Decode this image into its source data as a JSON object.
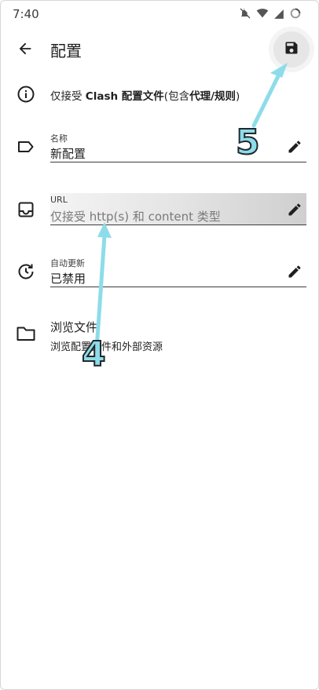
{
  "status_bar": {
    "time": "7:40"
  },
  "app_bar": {
    "title": "配置"
  },
  "info": {
    "prefix": "仅接受 ",
    "bold1": "Clash 配置文件",
    "middle": "(包含",
    "bold2": "代理/规则",
    "suffix": ")"
  },
  "fields": {
    "name": {
      "label": "名称",
      "value": "新配置"
    },
    "url": {
      "label": "URL",
      "placeholder": "仅接受 http(s) 和 content 类型"
    },
    "auto_update": {
      "label": "自动更新",
      "value": "已禁用"
    }
  },
  "browse": {
    "title": "浏览文件",
    "subtitle": "浏览配置文件和外部资源"
  },
  "annotations": {
    "step4": "4",
    "step5": "5",
    "color": "#8ddcea"
  },
  "icons": {
    "back": "arrow-left-icon",
    "save": "save-icon",
    "info": "info-icon",
    "name": "label-tag-icon",
    "url": "inbox-icon",
    "auto_update": "update-clock-icon",
    "browse": "folder-icon",
    "edit": "pencil-icon"
  }
}
